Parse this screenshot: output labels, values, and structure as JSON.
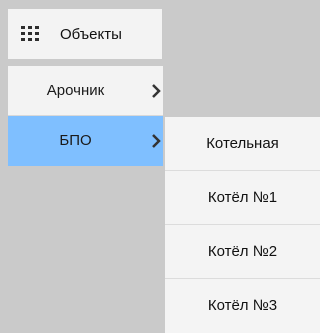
{
  "toolbar": {
    "icon": "grid-icon",
    "label": "Объекты"
  },
  "menu": {
    "items": [
      {
        "label": "Арочник",
        "icon": "chevron-right-icon"
      },
      {
        "label": "БПО",
        "icon": "chevron-right-icon"
      }
    ]
  },
  "submenu": {
    "items": [
      {
        "label": "Котельная"
      },
      {
        "label": "Котёл №1"
      },
      {
        "label": "Котёл №2"
      },
      {
        "label": "Котёл №3"
      }
    ]
  }
}
